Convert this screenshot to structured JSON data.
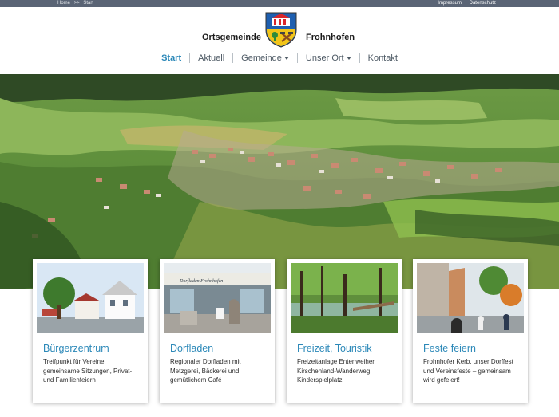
{
  "topbar": {
    "crumb_home": "Home",
    "crumb_sep": ">>",
    "crumb_current": "Start",
    "link_impressum": "Impressum",
    "link_datenschutz": "Datenschutz"
  },
  "header": {
    "title_left": "Ortsgemeinde",
    "title_right": "Frohnhofen"
  },
  "nav": {
    "start": "Start",
    "aktuell": "Aktuell",
    "gemeinde": "Gemeinde",
    "unser_ort": "Unser Ort",
    "kontakt": "Kontakt"
  },
  "cards": [
    {
      "title": "Bürgerzentrum",
      "text": "Treffpunkt für Vereine, gemeinsame Sitzungen, Privat- und Familienfeiern"
    },
    {
      "title": "Dorfladen",
      "text": "Regionaler Dorfladen mit Metzgerei, Bäckerei und gemütlichem Café",
      "photo_sign": "Dorfladen Frohnhofen"
    },
    {
      "title": "Freizeit, Touristik",
      "text": "Freizeitanlage Entenweiher, Kirschenland-Wanderweg, Kinderspielplatz"
    },
    {
      "title": "Feste feiern",
      "text": "Frohnhofer Kerb, unser Dorffest und Vereinsfeste – gemeinsam wird gefeiert!"
    }
  ],
  "colors": {
    "accent": "#2b88b8",
    "topbar": "#5a6475"
  }
}
